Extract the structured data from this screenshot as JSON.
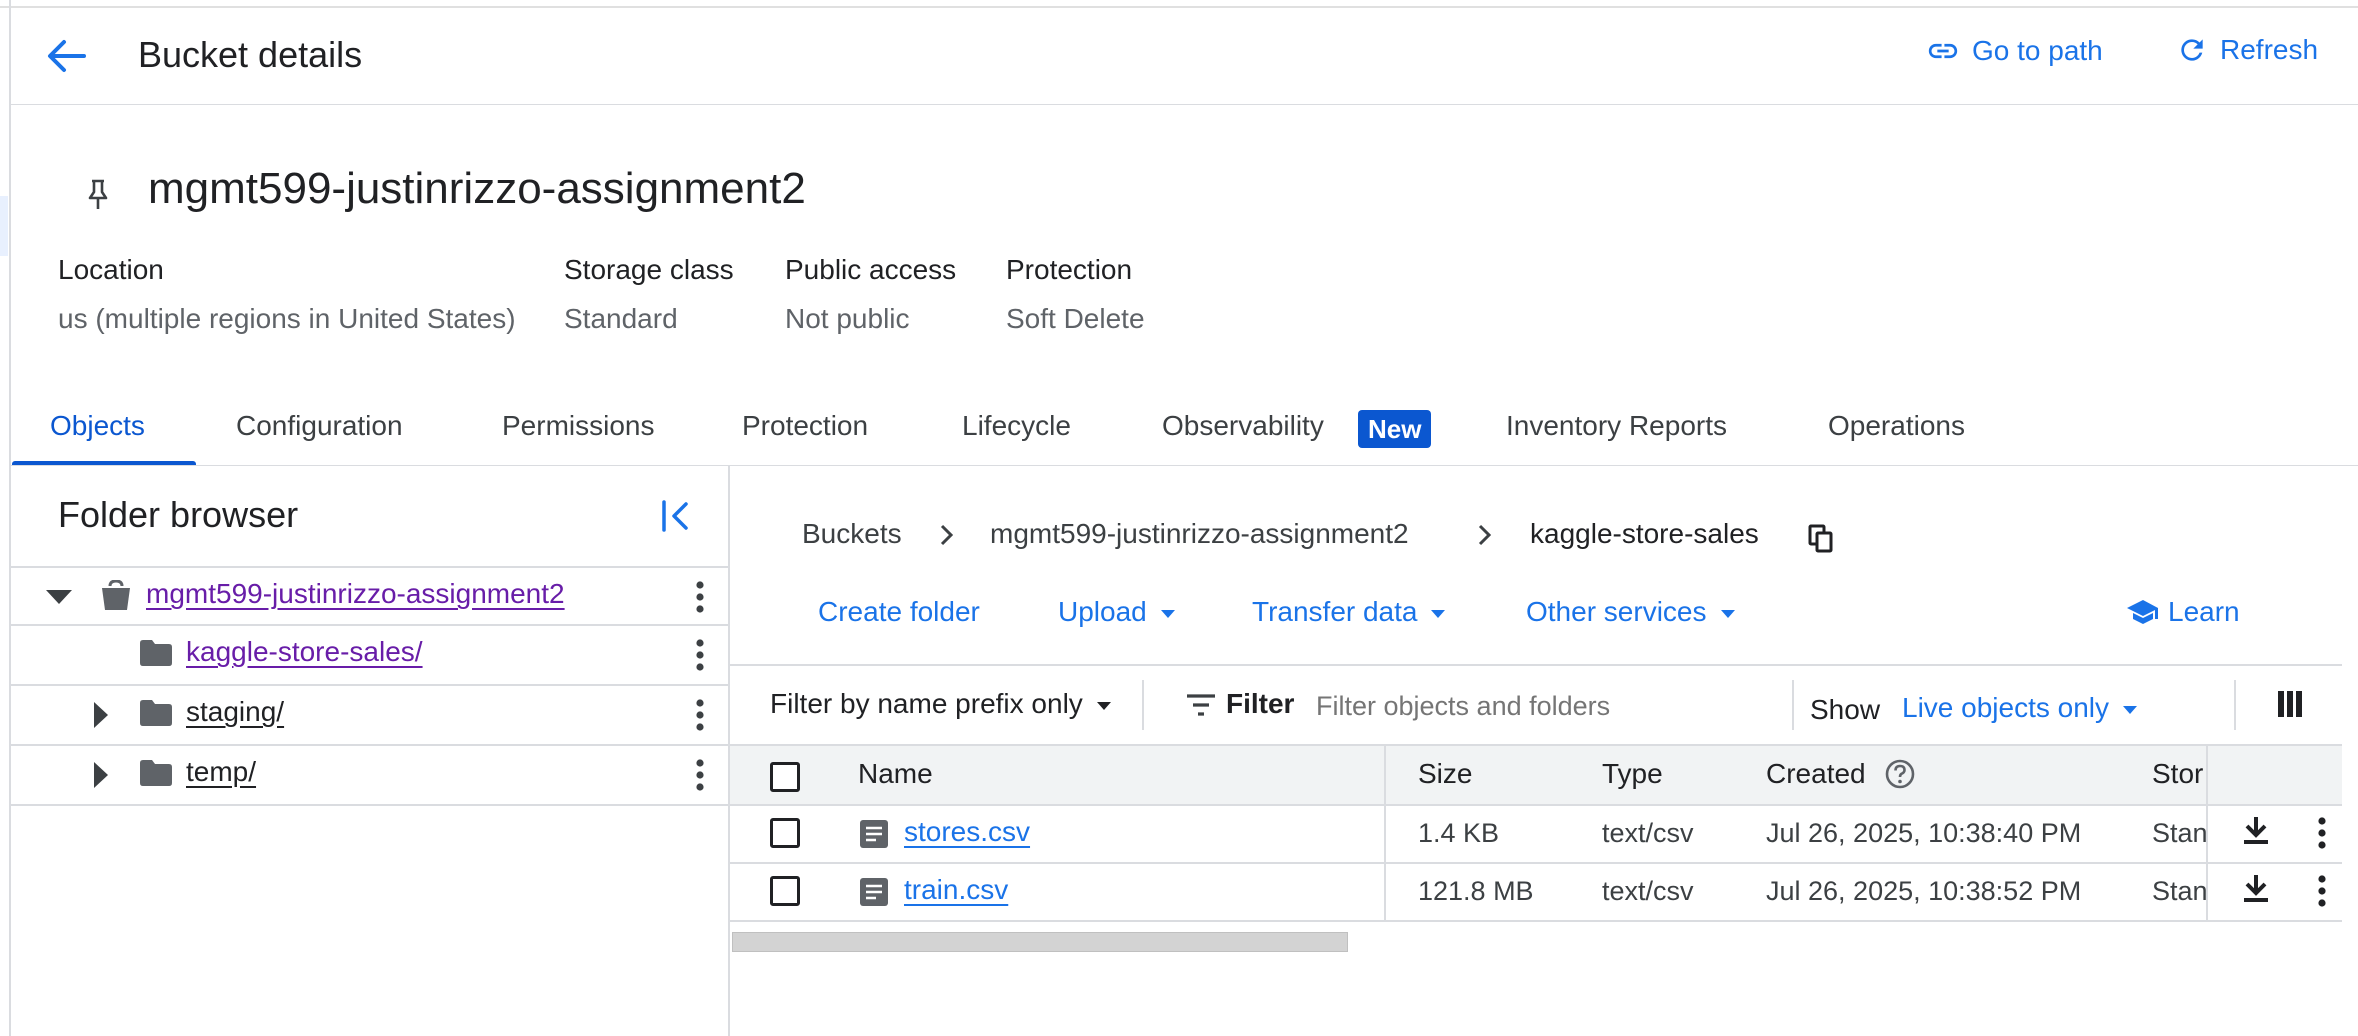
{
  "header": {
    "title": "Bucket details",
    "go_to_path": "Go to path",
    "refresh": "Refresh"
  },
  "bucket": {
    "name": "mgmt599-justinrizzo-assignment2",
    "meta": [
      {
        "label": "Location",
        "value": "us (multiple regions in United States)"
      },
      {
        "label": "Storage class",
        "value": "Standard"
      },
      {
        "label": "Public access",
        "value": "Not public"
      },
      {
        "label": "Protection",
        "value": "Soft Delete"
      }
    ]
  },
  "tabs": [
    {
      "label": "Objects",
      "active": true
    },
    {
      "label": "Configuration"
    },
    {
      "label": "Permissions"
    },
    {
      "label": "Protection"
    },
    {
      "label": "Lifecycle"
    },
    {
      "label": "Observability",
      "badge": "New"
    },
    {
      "label": "Inventory Reports"
    },
    {
      "label": "Operations"
    }
  ],
  "folder_browser": {
    "title": "Folder browser",
    "tree": [
      {
        "label": "mgmt599-justinrizzo-assignment2",
        "type": "bucket",
        "expanded": true
      },
      {
        "label": "kaggle-store-sales/",
        "type": "folder",
        "selected": true
      },
      {
        "label": "staging/",
        "type": "folder",
        "expandable": true
      },
      {
        "label": "temp/",
        "type": "folder",
        "expandable": true
      }
    ]
  },
  "breadcrumb": {
    "items": [
      "Buckets",
      "mgmt599-justinrizzo-assignment2",
      "kaggle-store-sales"
    ]
  },
  "actions": {
    "create_folder": "Create folder",
    "upload": "Upload",
    "transfer_data": "Transfer data",
    "other_services": "Other services",
    "learn": "Learn"
  },
  "filter": {
    "mode": "Filter by name prefix only",
    "filter_label": "Filter",
    "placeholder": "Filter objects and folders",
    "show_label": "Show",
    "show_value": "Live objects only"
  },
  "table": {
    "columns": [
      "Name",
      "Size",
      "Type",
      "Created",
      "Stor"
    ],
    "rows": [
      {
        "name": "stores.csv",
        "size": "1.4 KB",
        "type": "text/csv",
        "created": "Jul 26, 2025, 10:38:40 PM",
        "storage": "Stan"
      },
      {
        "name": "train.csv",
        "size": "121.8 MB",
        "type": "text/csv",
        "created": "Jul 26, 2025, 10:38:52 PM",
        "storage": "Stan"
      }
    ]
  },
  "colors": {
    "accent": "#1a73e8",
    "active_tab": "#0b57d0",
    "visited_link": "#681da8"
  }
}
